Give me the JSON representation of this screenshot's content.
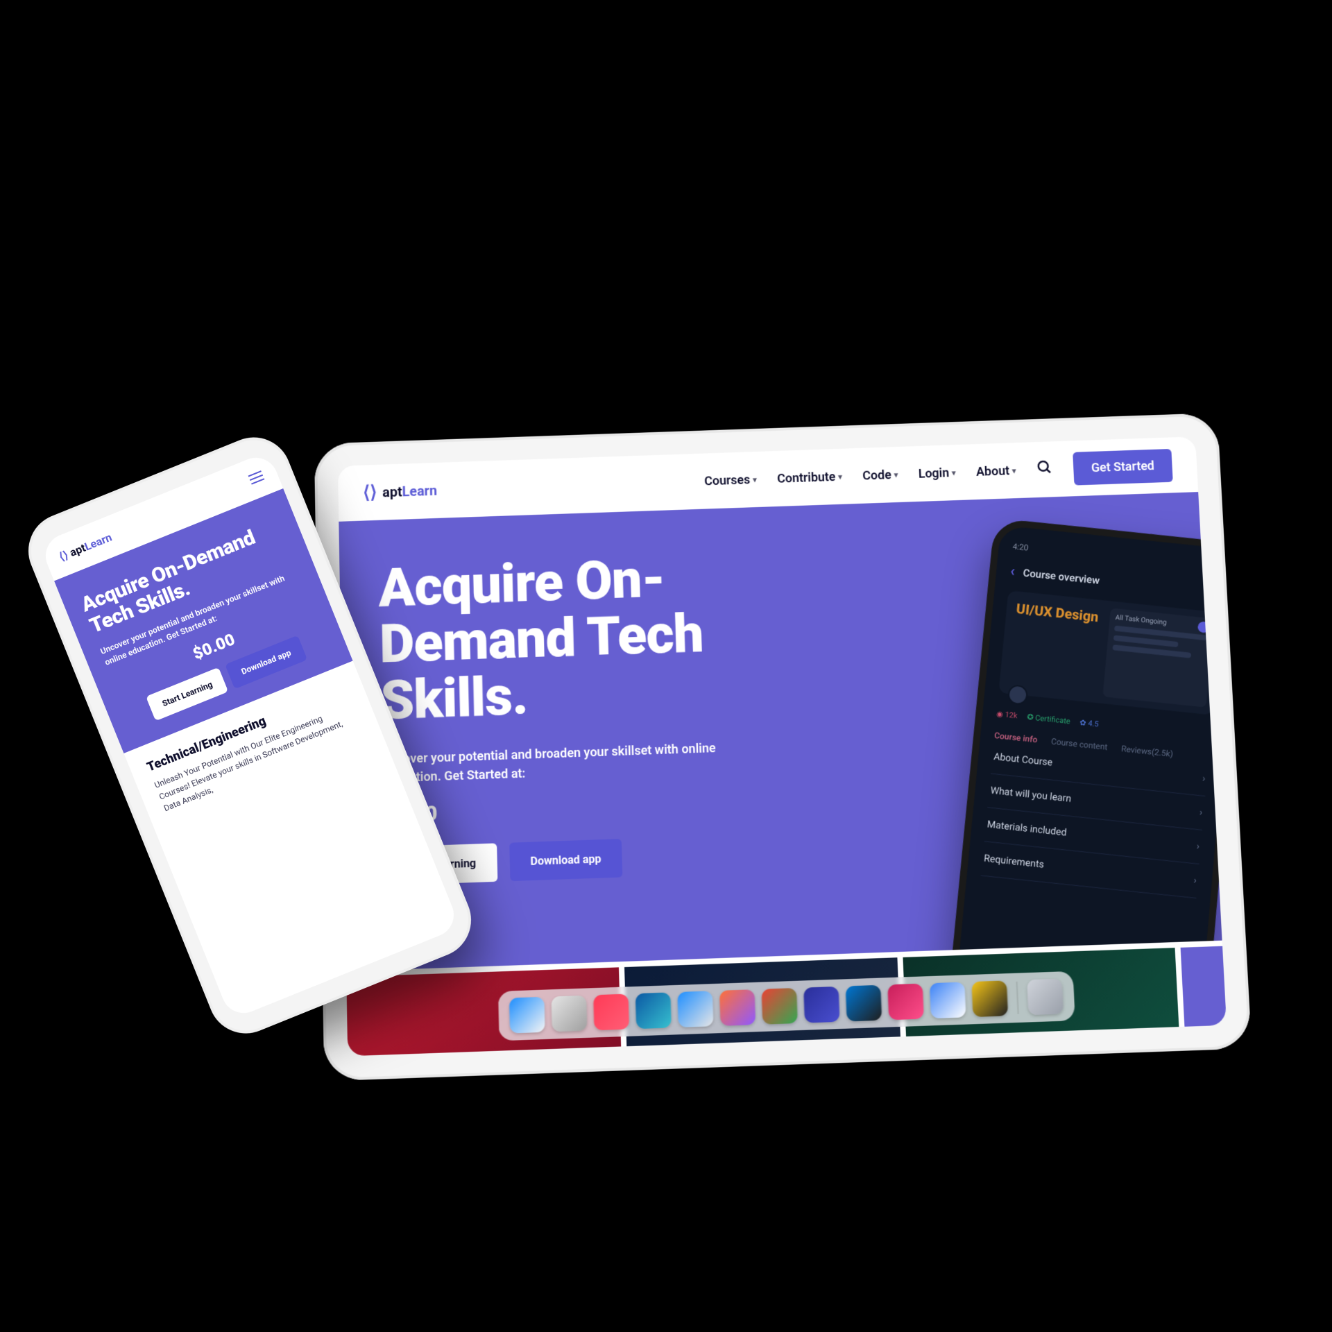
{
  "brand": {
    "name_part1": "apt",
    "name_part2": "Learn"
  },
  "tablet": {
    "nav": [
      "Courses",
      "Contribute",
      "Code",
      "Login",
      "About"
    ],
    "cta": "Get Started",
    "hero": {
      "title": "Acquire On-Demand Tech Skills.",
      "subtitle": "Uncover your potential and broaden your skillset with online education. Get Started at:",
      "price": "$0.00",
      "btn_primary": "Start Learning",
      "btn_secondary": "Download app"
    },
    "hero_phone": {
      "time": "4:20",
      "title": "Course overview",
      "card_title": "UI/UX Design",
      "subcard_title": "All Task Ongoing",
      "chip_views": "12k",
      "chip_cert": "Certificate",
      "chip_rating": "4.5",
      "tabs": {
        "info": "Course info",
        "content": "Course content",
        "reviews": "Reviews(2.5k)"
      },
      "rows": [
        "About Course",
        "What will you learn",
        "Materials included",
        "Requirements"
      ]
    }
  },
  "phone": {
    "hero": {
      "title": "Acquire On-Demand Tech Skills.",
      "subtitle": "Uncover your potential and broaden your skillset with online education. Get Started at:",
      "price": "$0.00",
      "btn_primary": "Start Learning",
      "btn_secondary": "Download app"
    },
    "section": {
      "title": "Technical/Engineering",
      "body": "Unleash Your Potential with Our Elite Engineering Courses! Elevate your skills in Software Development, Data Analysis,"
    }
  },
  "dock": {
    "apps": [
      {
        "name": "finder",
        "colors": [
          "#1e90ff",
          "#f5f5f5"
        ]
      },
      {
        "name": "launchpad",
        "colors": [
          "#e5e5e5",
          "#a0a0a0"
        ]
      },
      {
        "name": "music",
        "colors": [
          "#ff3b57",
          "#ff5e76"
        ]
      },
      {
        "name": "edge",
        "colors": [
          "#0c59a4",
          "#37c1d0"
        ]
      },
      {
        "name": "safari",
        "colors": [
          "#1f8fff",
          "#e6e6e6"
        ]
      },
      {
        "name": "firefox",
        "colors": [
          "#ff7139",
          "#9059ff"
        ]
      },
      {
        "name": "chrome",
        "colors": [
          "#ea4335",
          "#34a853"
        ]
      },
      {
        "name": "app1",
        "colors": [
          "#2a2f9b",
          "#4a4fd0"
        ]
      },
      {
        "name": "vscode",
        "colors": [
          "#0078d4",
          "#1f1f1f"
        ]
      },
      {
        "name": "app2",
        "colors": [
          "#c81f5b",
          "#ff4f8b"
        ]
      },
      {
        "name": "mail",
        "colors": [
          "#3b82f6",
          "#ffffff"
        ]
      },
      {
        "name": "app3",
        "colors": [
          "#f5c518",
          "#222222"
        ]
      },
      {
        "name": "trash",
        "colors": [
          "#d0d4db",
          "#9aa0aa"
        ]
      }
    ]
  }
}
